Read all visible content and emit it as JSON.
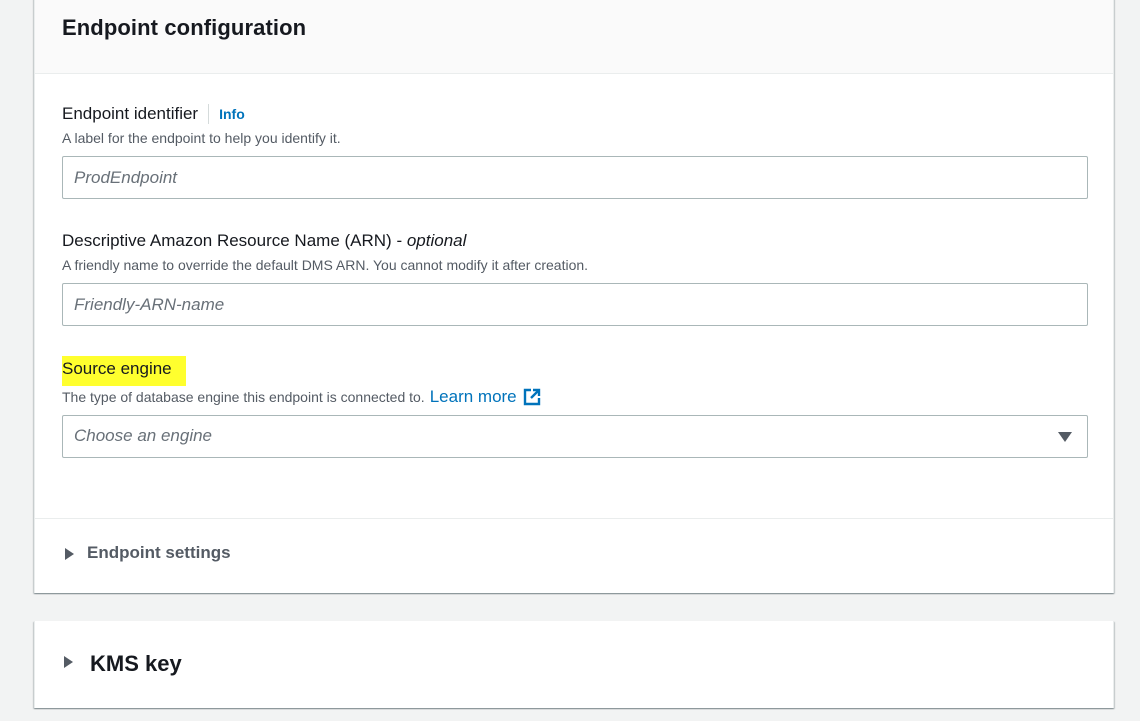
{
  "panel": {
    "title": "Endpoint configuration"
  },
  "endpoint_identifier": {
    "label": "Endpoint identifier",
    "info": "Info",
    "description": "A label for the endpoint to help you identify it.",
    "placeholder": "ProdEndpoint",
    "value": ""
  },
  "arn": {
    "label": "Descriptive Amazon Resource Name (ARN) - ",
    "optional": "optional",
    "description": "A friendly name to override the default DMS ARN. You cannot modify it after creation.",
    "placeholder": "Friendly-ARN-name",
    "value": ""
  },
  "source_engine": {
    "label": "Source engine",
    "description": "The type of database engine this endpoint is connected to.",
    "learn_more": "Learn more",
    "placeholder": "Choose an engine",
    "highlight_color": "#ffff2e"
  },
  "endpoint_settings": {
    "label": "Endpoint settings",
    "expanded": false
  },
  "kms_key": {
    "label": "KMS key",
    "expanded": false
  },
  "colors": {
    "link": "#0073bb",
    "text": "#16191f",
    "secondary_text": "#545b64",
    "background": "#f2f3f3",
    "border": "#aab7b8"
  },
  "icons": {
    "external_link": "external-link-icon",
    "dropdown": "caret-down-icon",
    "expand": "caret-right-icon"
  }
}
